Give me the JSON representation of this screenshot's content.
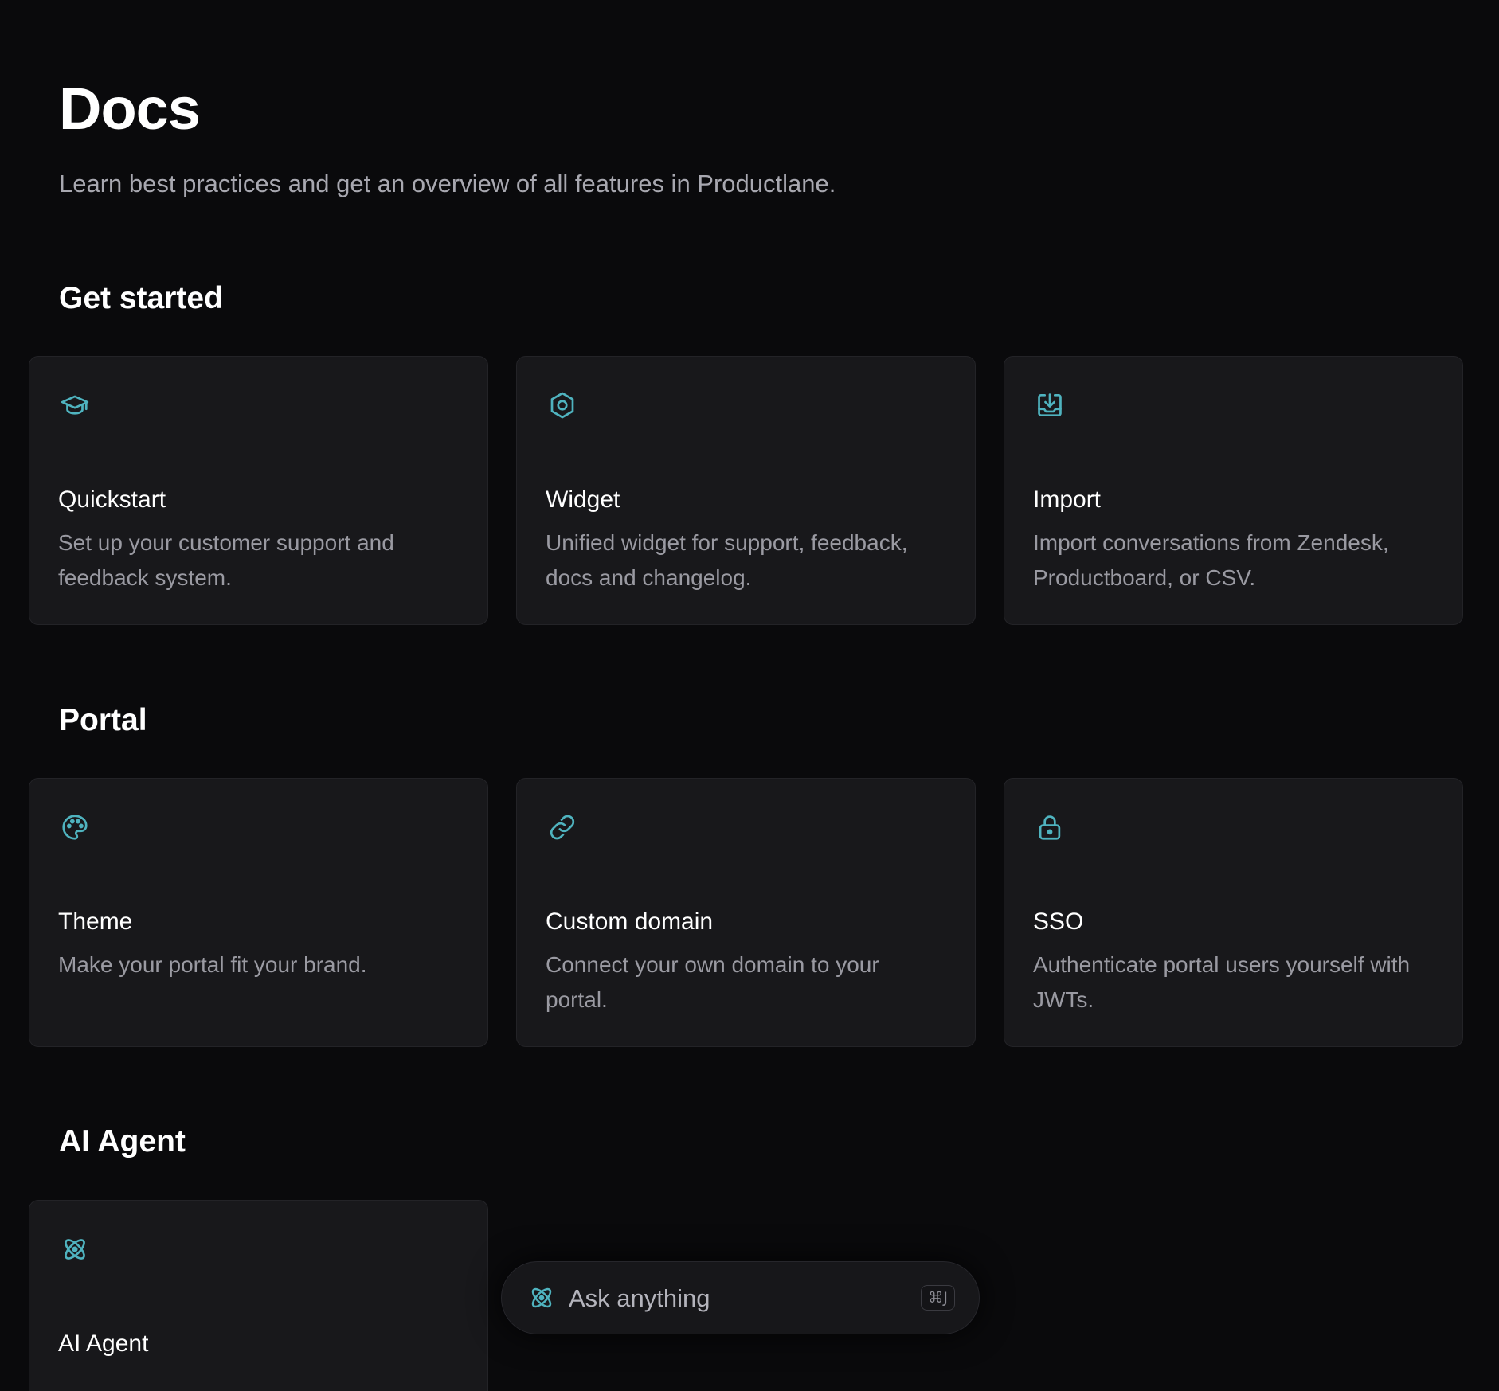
{
  "header": {
    "title": "Docs",
    "subtitle": "Learn best practices and get an overview of all features in Productlane."
  },
  "sections": [
    {
      "title": "Get started",
      "cards": [
        {
          "icon": "graduation-cap-icon",
          "title": "Quickstart",
          "description": "Set up your customer support and feedback system."
        },
        {
          "icon": "hexagon-gear-icon",
          "title": "Widget",
          "description": "Unified widget for support, feedback, docs and changelog."
        },
        {
          "icon": "import-tray-icon",
          "title": "Import",
          "description": "Import conversations from Zendesk, Productboard, or CSV."
        }
      ]
    },
    {
      "title": "Portal",
      "cards": [
        {
          "icon": "palette-icon",
          "title": "Theme",
          "description": "Make your portal fit your brand."
        },
        {
          "icon": "link-icon",
          "title": "Custom domain",
          "description": "Connect your own domain to your portal."
        },
        {
          "icon": "lock-icon",
          "title": "SSO",
          "description": "Authenticate portal users yourself with JWTs."
        }
      ]
    },
    {
      "title": "AI Agent",
      "cards": [
        {
          "icon": "atom-icon",
          "title": "AI Agent",
          "description": ""
        }
      ]
    }
  ],
  "ask_bar": {
    "icon": "atom-icon",
    "placeholder": "Ask anything",
    "shortcut": "⌘J"
  },
  "colors": {
    "background": "#0a0a0c",
    "card": "#18181b",
    "accent": "#4fb3bf",
    "muted_text": "#9a9aa2"
  }
}
